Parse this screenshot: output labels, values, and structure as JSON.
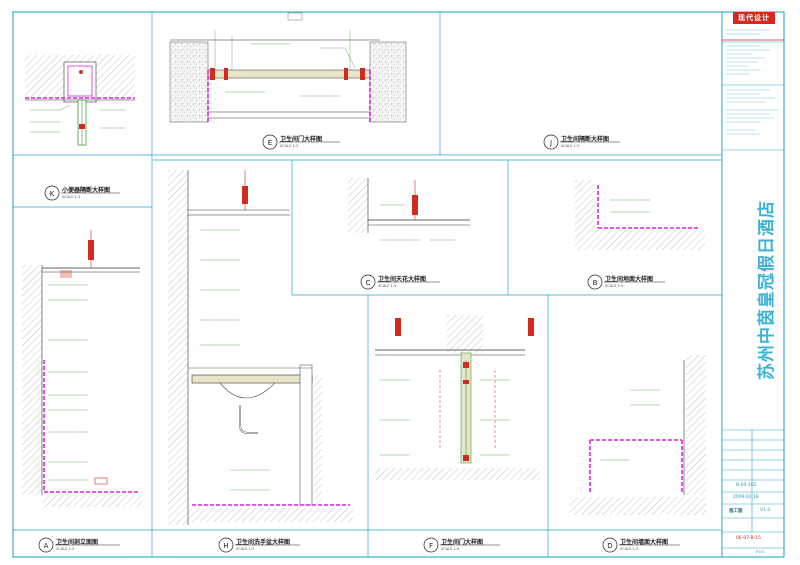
{
  "sheet": {
    "project_name": "苏州中茵皇冠假日酒店",
    "logo_text": "现代设计",
    "drawing_no": "B-05-102",
    "date": "2009.02.18",
    "stage": "施工图",
    "version": "V1.0",
    "doc_code": "0E-07-B-15",
    "page": "P101"
  },
  "details": [
    {
      "id": "K",
      "title": "小便器隔断大样图",
      "scale": "SCALE 1:5"
    },
    {
      "id": "E",
      "title": "卫生间门大样图",
      "scale": "SCALE 1:5"
    },
    {
      "id": "J",
      "title": "卫生间隔断大样图",
      "scale": "SCALE 1:5"
    },
    {
      "id": "C",
      "title": "卫生间天花大样图",
      "scale": "SCALE 1:5"
    },
    {
      "id": "B",
      "title": "卫生间地面大样图",
      "scale": "SCALE 1:5"
    },
    {
      "id": "A",
      "title": "卫生间剖立面图",
      "scale": "SCALE 1:5"
    },
    {
      "id": "H",
      "title": "卫生间洗手盆大样图",
      "scale": "SCALE 1:5"
    },
    {
      "id": "F",
      "title": "卫生间门大样图",
      "scale": "SCALE 1:5"
    },
    {
      "id": "D",
      "title": "卫生间墙面大样图",
      "scale": "SCALE 1:5"
    }
  ],
  "colors": {
    "border": "#2aa7c9",
    "magenta": "#e020e0",
    "red": "#d12a1e",
    "green": "#3aa13a",
    "hatch": "#999999",
    "fill": "#e8e4c8"
  }
}
